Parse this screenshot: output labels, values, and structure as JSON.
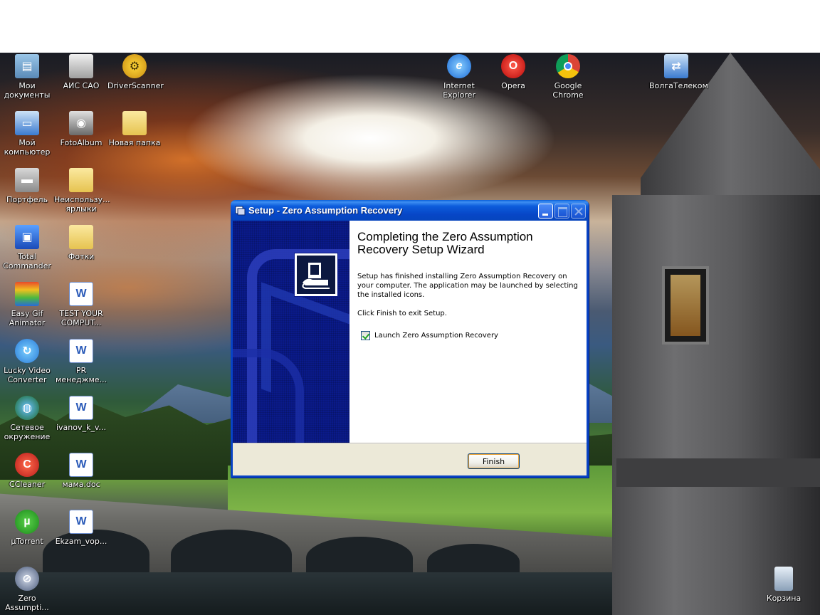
{
  "desktop": {
    "icons": [
      {
        "id": "my-documents",
        "label": "Мои документы",
        "icon": "folder-documents-icon"
      },
      {
        "id": "ais-sao",
        "label": "АИС САО",
        "icon": "app-icon"
      },
      {
        "id": "driverscanner",
        "label": "DriverScanner",
        "icon": "driverscanner-icon"
      },
      {
        "id": "my-computer",
        "label": "Мой компьютер",
        "icon": "computer-icon"
      },
      {
        "id": "fotoalbum",
        "label": "FotoAlbum",
        "icon": "camera-icon"
      },
      {
        "id": "new-folder",
        "label": "Новая папка",
        "icon": "folder-icon"
      },
      {
        "id": "briefcase",
        "label": "Портфель",
        "icon": "briefcase-icon"
      },
      {
        "id": "unused-shortcuts",
        "label": "Неиспользу... ярлыки",
        "icon": "folder-icon"
      },
      {
        "id": "total-commander",
        "label": "Total Commander",
        "icon": "floppy-icon"
      },
      {
        "id": "fotki",
        "label": "Фотки",
        "icon": "folder-icon"
      },
      {
        "id": "easy-gif-animator",
        "label": "Easy Gif Animator",
        "icon": "gif-animator-icon"
      },
      {
        "id": "test-your-computer",
        "label": "TEST YOUR COMPUT...",
        "icon": "word-document-icon"
      },
      {
        "id": "lucky-video-converter",
        "label": "Lucky Video Converter",
        "icon": "video-converter-icon"
      },
      {
        "id": "pr-menedzhment",
        "label": "PR менеджме...",
        "icon": "word-document-icon"
      },
      {
        "id": "network",
        "label": "Сетевое окружение",
        "icon": "network-icon"
      },
      {
        "id": "ivanov",
        "label": "ivanov_k_v...",
        "icon": "word-document-icon"
      },
      {
        "id": "ccleaner",
        "label": "CCleaner",
        "icon": "ccleaner-icon"
      },
      {
        "id": "mama-doc",
        "label": "мама.doc",
        "icon": "word-document-icon"
      },
      {
        "id": "utorrent",
        "label": "µTorrent",
        "icon": "utorrent-icon"
      },
      {
        "id": "ekzam",
        "label": "Ekzam_vop...",
        "icon": "word-document-icon"
      },
      {
        "id": "zero-assumption",
        "label": "Zero Assumpti...",
        "icon": "zero-assumption-icon"
      },
      {
        "id": "internet-explorer",
        "label": "Internet Explorer",
        "icon": "internet-explorer-icon"
      },
      {
        "id": "opera",
        "label": "Opera",
        "icon": "opera-icon"
      },
      {
        "id": "google-chrome",
        "label": "Google Chrome",
        "icon": "chrome-icon"
      },
      {
        "id": "volgatelecom",
        "label": "ВолгаТелеком",
        "icon": "network-connection-icon"
      },
      {
        "id": "recycle-bin",
        "label": "Корзина",
        "icon": "recycle-bin-icon"
      }
    ]
  },
  "window": {
    "title": "Setup - Zero Assumption Recovery",
    "heading": "Completing the Zero Assumption Recovery Setup Wizard",
    "body": "Setup has finished installing Zero Assumption Recovery on your computer. The application may be launched by selecting the installed icons.",
    "click_finish": "Click Finish to exit Setup.",
    "launch_label": "Launch Zero Assumption Recovery",
    "launch_checked": true,
    "finish_label": "Finish",
    "colors": {
      "titlebar": "#0746c7",
      "side_panel": "#0a1a8a"
    }
  }
}
